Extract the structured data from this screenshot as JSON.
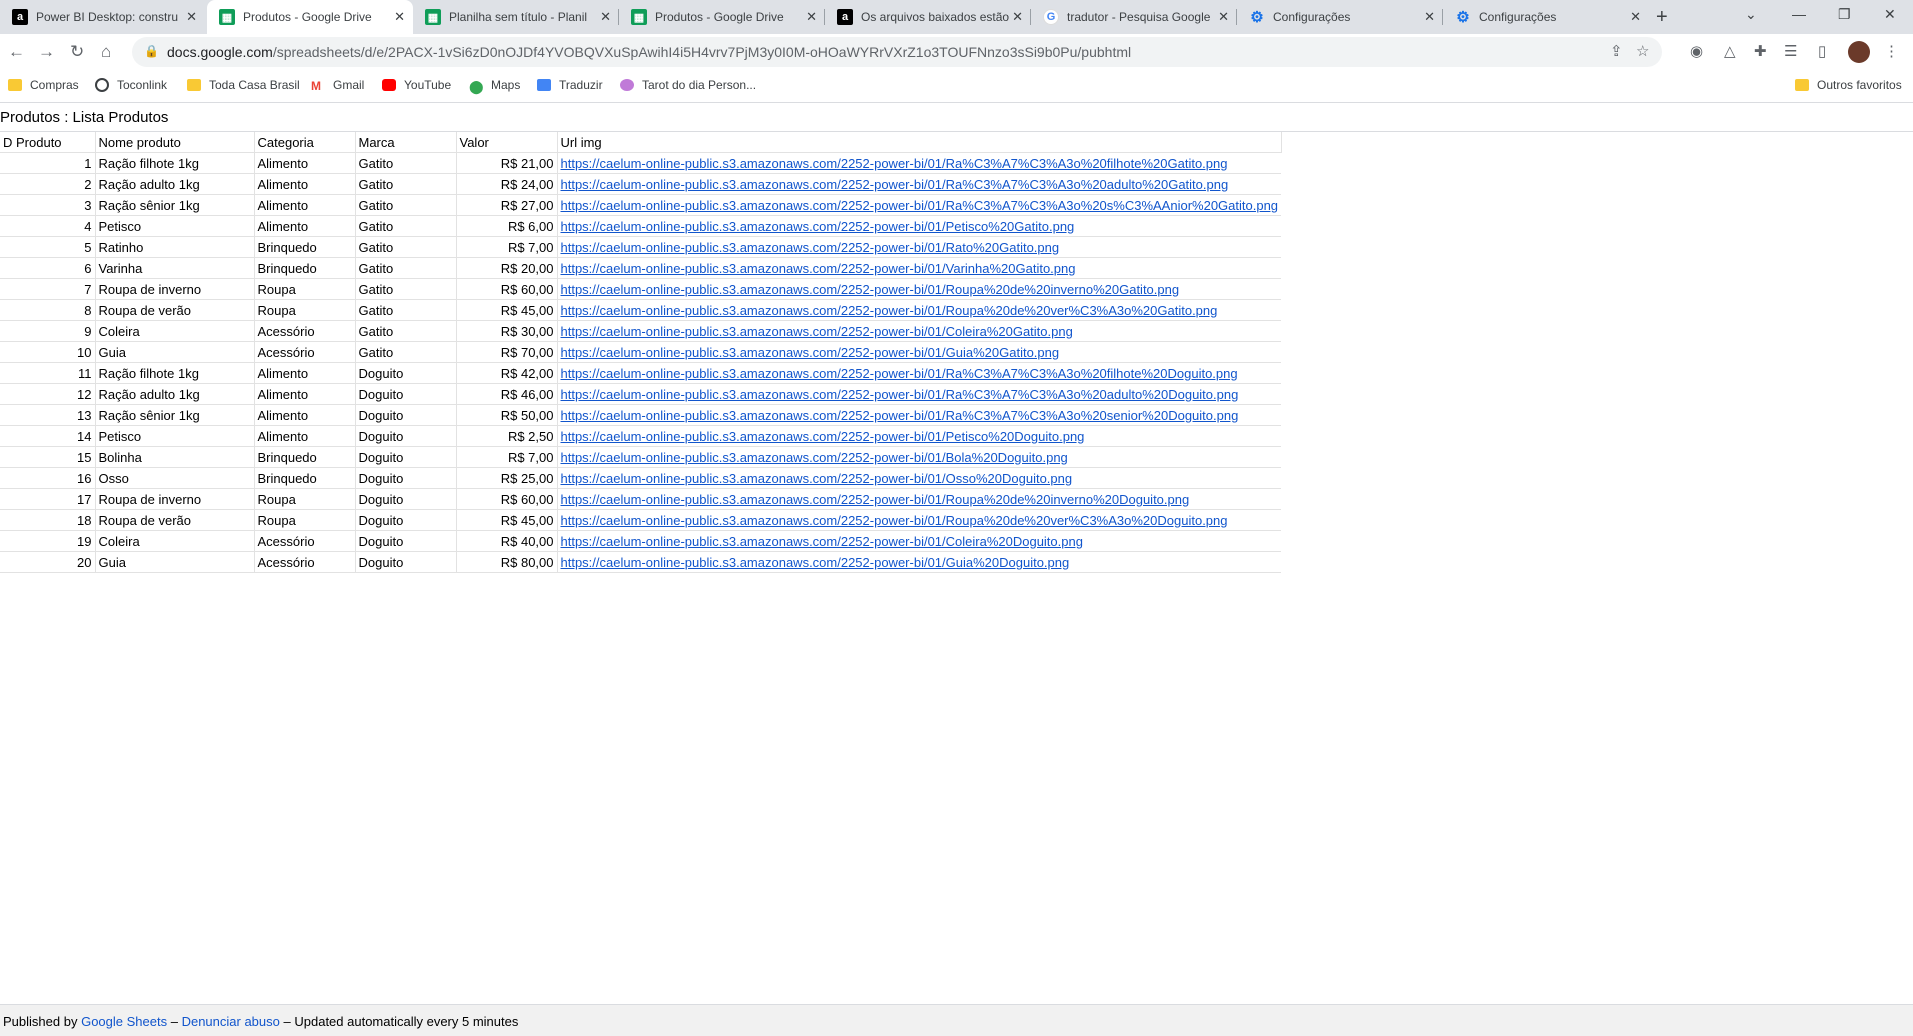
{
  "browser": {
    "tabs": [
      {
        "title": "Power BI Desktop: constru",
        "icon": "alura-icon"
      },
      {
        "title": "Produtos - Google Drive",
        "icon": "sheets-icon",
        "active": true
      },
      {
        "title": "Planilha sem título - Planil",
        "icon": "sheets-icon"
      },
      {
        "title": "Produtos - Google Drive",
        "icon": "sheets-icon"
      },
      {
        "title": "Os arquivos baixados estão",
        "icon": "alura-icon"
      },
      {
        "title": "tradutor - Pesquisa Google",
        "icon": "google-icon"
      },
      {
        "title": "Configurações",
        "icon": "gear-icon"
      },
      {
        "title": "Configurações",
        "icon": "gear-icon"
      }
    ],
    "url_host": "docs.google.com",
    "url_path": "/spreadsheets/d/e/2PACX-1vSi6zD0nOJDf4YVOBQVXuSpAwihI4i5H4vrv7PjM3y0I0M-oHOaWYRrVXrZ1o3TOUFNnzo3sSi9b0Pu/pubhtml",
    "bookmarks": [
      {
        "label": "Compras",
        "icon": "folder-icon"
      },
      {
        "label": "Toconlink",
        "icon": "globe-icon"
      },
      {
        "label": "Toda Casa Brasil",
        "icon": "folder-icon"
      },
      {
        "label": "Gmail",
        "icon": "gmail-icon"
      },
      {
        "label": "YouTube",
        "icon": "youtube-icon"
      },
      {
        "label": "Maps",
        "icon": "maps-icon"
      },
      {
        "label": "Traduzir",
        "icon": "translate-icon"
      },
      {
        "label": "Tarot do dia Person...",
        "icon": "tarot-icon"
      }
    ],
    "other_bookmarks": "Outros favoritos"
  },
  "sheet": {
    "title": "Produtos : Lista Produtos",
    "headers": [
      "D Produto",
      "Nome produto",
      "Categoria",
      "Marca",
      "Valor",
      "Url img"
    ],
    "rows": [
      [
        "1",
        "Ração filhote 1kg",
        "Alimento",
        "Gatito",
        "R$ 21,00",
        "https://caelum-online-public.s3.amazonaws.com/2252-power-bi/01/Ra%C3%A7%C3%A3o%20filhote%20Gatito.png"
      ],
      [
        "2",
        "Ração adulto 1kg",
        "Alimento",
        "Gatito",
        "R$ 24,00",
        "https://caelum-online-public.s3.amazonaws.com/2252-power-bi/01/Ra%C3%A7%C3%A3o%20adulto%20Gatito.png"
      ],
      [
        "3",
        "Ração sênior 1kg",
        "Alimento",
        "Gatito",
        "R$ 27,00",
        "https://caelum-online-public.s3.amazonaws.com/2252-power-bi/01/Ra%C3%A7%C3%A3o%20s%C3%AAnior%20Gatito.png"
      ],
      [
        "4",
        "Petisco",
        "Alimento",
        "Gatito",
        "R$ 6,00",
        "https://caelum-online-public.s3.amazonaws.com/2252-power-bi/01/Petisco%20Gatito.png"
      ],
      [
        "5",
        "Ratinho",
        "Brinquedo",
        "Gatito",
        "R$ 7,00",
        "https://caelum-online-public.s3.amazonaws.com/2252-power-bi/01/Rato%20Gatito.png"
      ],
      [
        "6",
        "Varinha",
        "Brinquedo",
        "Gatito",
        "R$ 20,00",
        "https://caelum-online-public.s3.amazonaws.com/2252-power-bi/01/Varinha%20Gatito.png"
      ],
      [
        "7",
        "Roupa de inverno",
        "Roupa",
        "Gatito",
        "R$ 60,00",
        "https://caelum-online-public.s3.amazonaws.com/2252-power-bi/01/Roupa%20de%20inverno%20Gatito.png"
      ],
      [
        "8",
        "Roupa de verão",
        "Roupa",
        "Gatito",
        "R$ 45,00",
        "https://caelum-online-public.s3.amazonaws.com/2252-power-bi/01/Roupa%20de%20ver%C3%A3o%20Gatito.png"
      ],
      [
        "9",
        "Coleira",
        "Acessório",
        "Gatito",
        "R$ 30,00",
        "https://caelum-online-public.s3.amazonaws.com/2252-power-bi/01/Coleira%20Gatito.png"
      ],
      [
        "10",
        "Guia",
        "Acessório",
        "Gatito",
        "R$ 70,00",
        "https://caelum-online-public.s3.amazonaws.com/2252-power-bi/01/Guia%20Gatito.png"
      ],
      [
        "11",
        "Ração filhote 1kg",
        "Alimento",
        "Doguito",
        "R$ 42,00",
        "https://caelum-online-public.s3.amazonaws.com/2252-power-bi/01/Ra%C3%A7%C3%A3o%20filhote%20Doguito.png"
      ],
      [
        "12",
        "Ração adulto 1kg",
        "Alimento",
        "Doguito",
        "R$ 46,00",
        "https://caelum-online-public.s3.amazonaws.com/2252-power-bi/01/Ra%C3%A7%C3%A3o%20adulto%20Doguito.png"
      ],
      [
        "13",
        "Ração sênior 1kg",
        "Alimento",
        "Doguito",
        "R$ 50,00",
        "https://caelum-online-public.s3.amazonaws.com/2252-power-bi/01/Ra%C3%A7%C3%A3o%20senior%20Doguito.png"
      ],
      [
        "14",
        "Petisco",
        "Alimento",
        "Doguito",
        "R$ 2,50",
        "https://caelum-online-public.s3.amazonaws.com/2252-power-bi/01/Petisco%20Doguito.png"
      ],
      [
        "15",
        "Bolinha",
        "Brinquedo",
        "Doguito",
        "R$ 7,00",
        "https://caelum-online-public.s3.amazonaws.com/2252-power-bi/01/Bola%20Doguito.png"
      ],
      [
        "16",
        "Osso",
        "Brinquedo",
        "Doguito",
        "R$ 25,00",
        "https://caelum-online-public.s3.amazonaws.com/2252-power-bi/01/Osso%20Doguito.png"
      ],
      [
        "17",
        "Roupa de inverno",
        "Roupa",
        "Doguito",
        "R$ 60,00",
        "https://caelum-online-public.s3.amazonaws.com/2252-power-bi/01/Roupa%20de%20inverno%20Doguito.png"
      ],
      [
        "18",
        "Roupa de verão",
        "Roupa",
        "Doguito",
        "R$ 45,00",
        "https://caelum-online-public.s3.amazonaws.com/2252-power-bi/01/Roupa%20de%20ver%C3%A3o%20Doguito.png"
      ],
      [
        "19",
        "Coleira",
        "Acessório",
        "Doguito",
        "R$ 40,00",
        "https://caelum-online-public.s3.amazonaws.com/2252-power-bi/01/Coleira%20Doguito.png"
      ],
      [
        "20",
        "Guia",
        "Acessório",
        "Doguito",
        "R$ 80,00",
        "https://caelum-online-public.s3.amazonaws.com/2252-power-bi/01/Guia%20Doguito.png"
      ]
    ]
  },
  "footer": {
    "published_by": "Published by",
    "google_sheets": "Google Sheets",
    "dash1": "–",
    "report_abuse": "Denunciar abuso",
    "dash2": "–",
    "updated": "Updated automatically every 5 minutes"
  },
  "colors": {
    "link": "#1155cc",
    "tabstrip": "#dee1e6",
    "sheets_green": "#0f9d58"
  }
}
